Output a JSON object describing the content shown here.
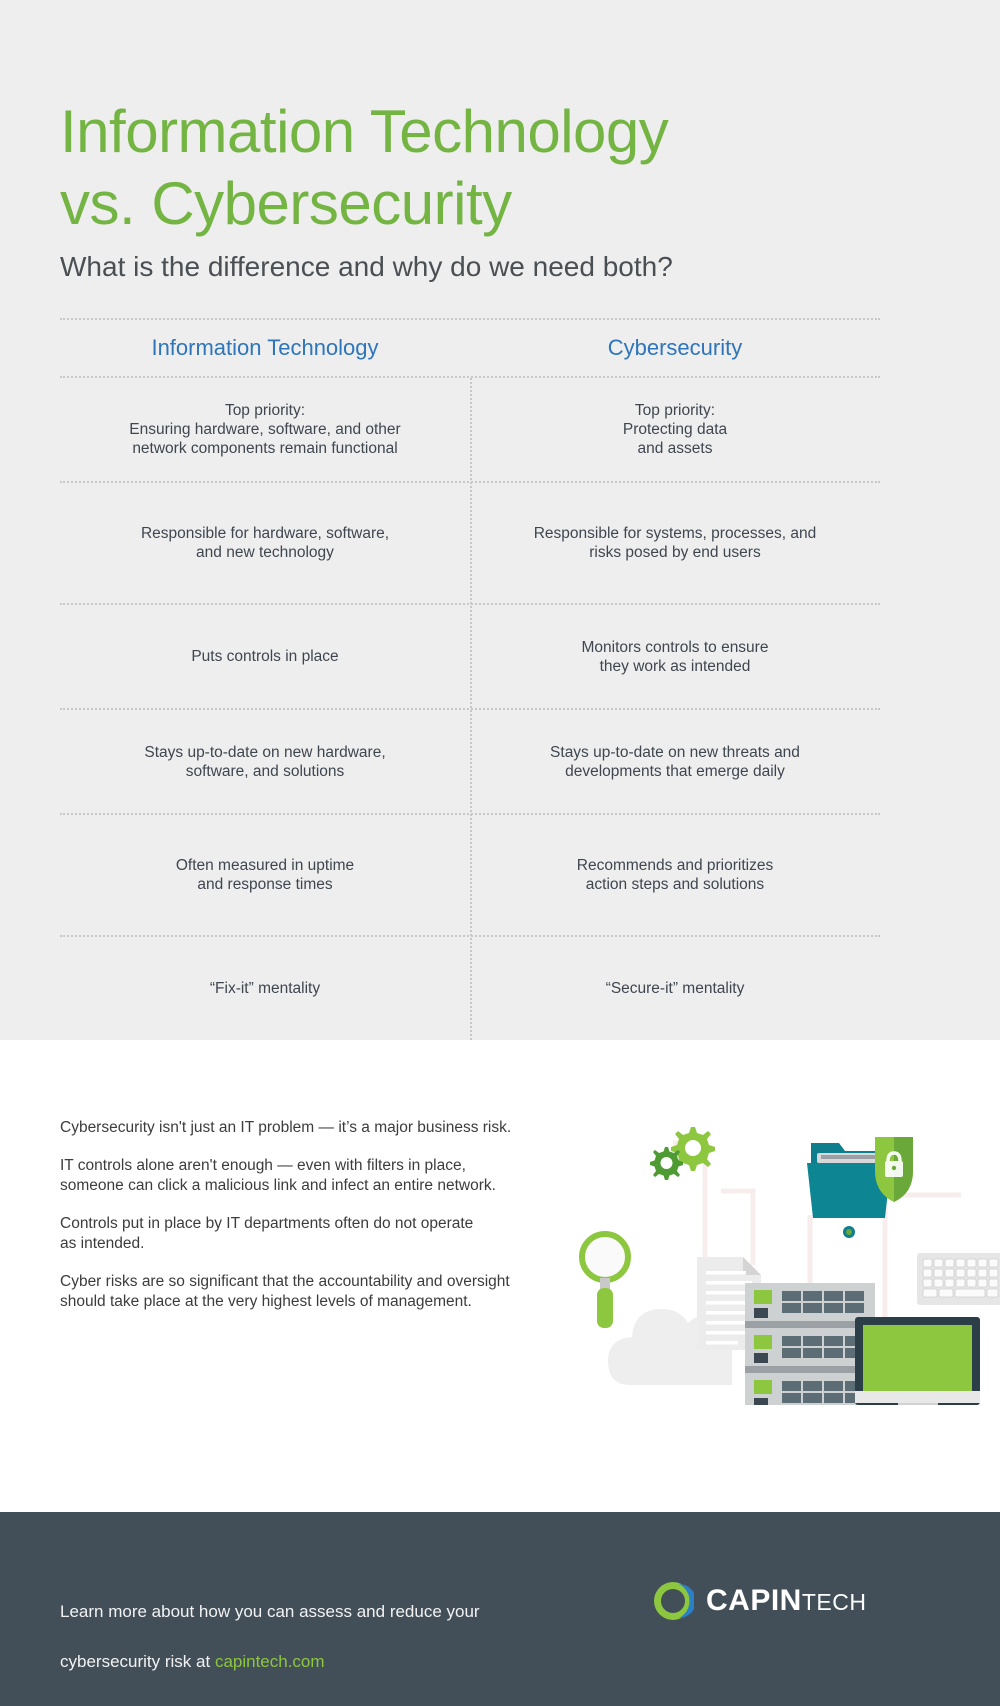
{
  "header": {
    "title": "Information Technology\nvs. Cybersecurity",
    "subtitle": "What is the difference and why do we need both?"
  },
  "comparison": {
    "columns": [
      "Information Technology",
      "Cybersecurity"
    ],
    "rows": [
      {
        "it": "Top priority:\nEnsuring hardware, software, and other\nnetwork components remain functional",
        "cyber": "Top priority:\nProtecting data\nand assets"
      },
      {
        "it": "Responsible for hardware, software,\nand new technology",
        "cyber": "Responsible for systems, processes, and\nrisks posed by end users"
      },
      {
        "it": "Puts controls in place",
        "cyber": "Monitors controls to ensure\nthey work as intended"
      },
      {
        "it": "Stays up-to-date on new hardware,\nsoftware, and solutions",
        "cyber": "Stays up-to-date on new threats and\ndevelopments that emerge daily"
      },
      {
        "it": "Often measured in uptime\nand response times",
        "cyber": "Recommends and prioritizes\naction steps and solutions"
      },
      {
        "it": "“Fix-it” mentality",
        "cyber": "“Secure-it” mentality"
      }
    ]
  },
  "body": {
    "paragraphs": [
      "Cybersecurity isn't just an IT problem — it’s a major business risk.",
      "IT controls alone aren't enough — even with filters in place,\nsomeone can click a malicious link and infect an entire network.",
      "Controls put in place by IT departments often do not operate\nas intended.",
      "Cyber risks are so significant that the accountability and oversight\nshould take place at the very highest levels of management."
    ]
  },
  "illustration": {
    "elements": [
      "gears-icon",
      "magnifier-icon",
      "document-icon",
      "folder-lock-icon",
      "shield-lock-icon",
      "server-rack-icon",
      "monitor-icon",
      "keyboard-icon",
      "cloud-icon"
    ]
  },
  "footer": {
    "cta_line1": "Learn more about how you can assess and reduce your",
    "cta_line2_prefix": "cybersecurity risk at ",
    "cta_link": "capintech.com",
    "logo_capin": "Capin",
    "logo_tech": "Tech"
  },
  "colors": {
    "title_green": "#74b443",
    "accent_green": "#8dc63f",
    "header_blue": "#2e75bb",
    "body_text": "#3f4650",
    "panel_gray": "#eeeeee",
    "footer_dark": "#434f58",
    "teal": "#0f7e8c"
  }
}
